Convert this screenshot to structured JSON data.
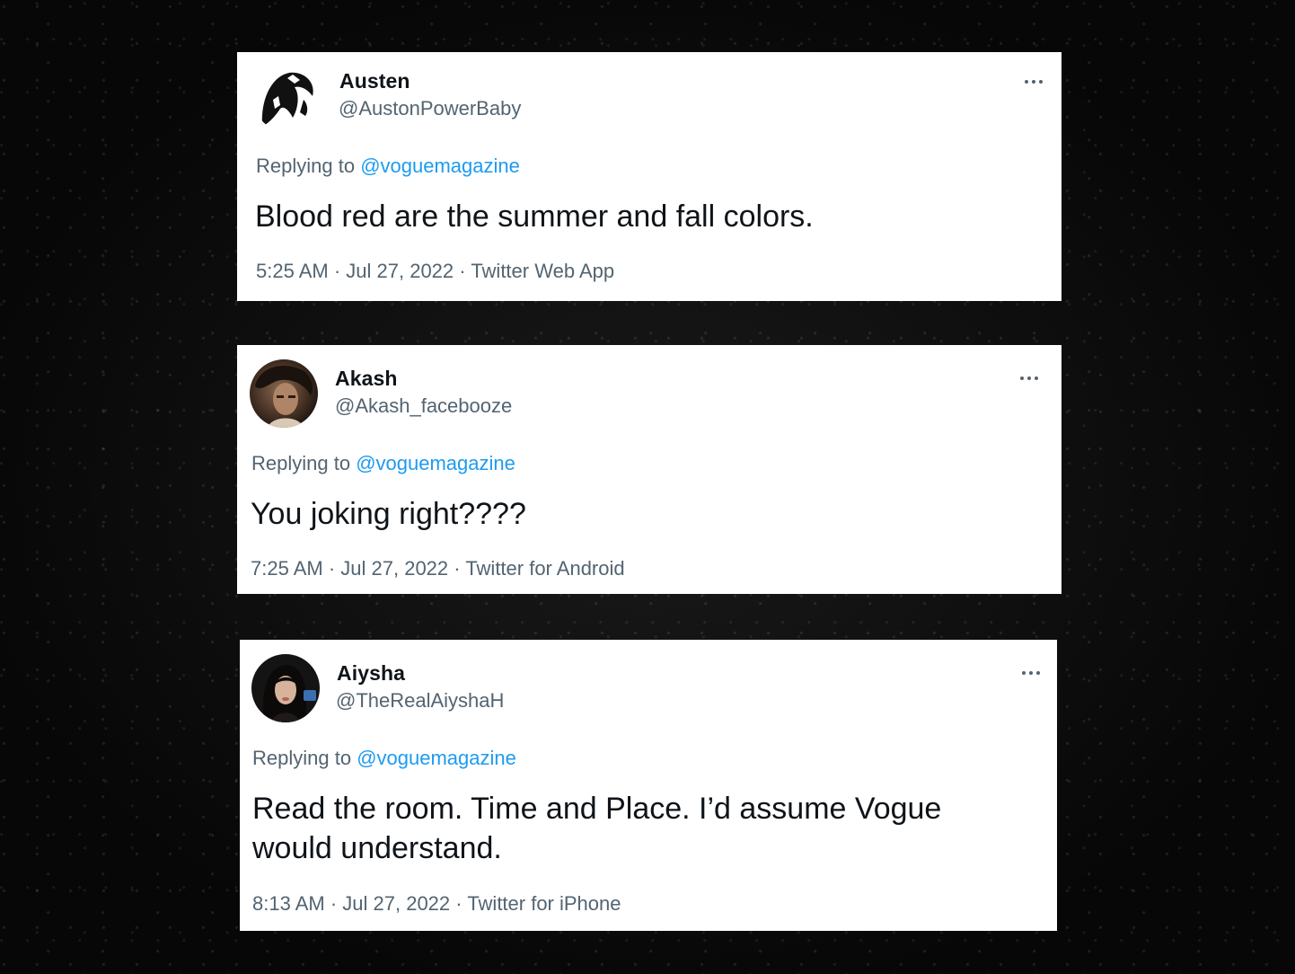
{
  "tweets": [
    {
      "name": "Austen",
      "handle": "@AustonPowerBaby",
      "replying_prefix": "Replying to ",
      "replying_to": "@voguemagazine",
      "text": "Blood red are the summer and fall colors.",
      "time": "5:25 AM",
      "date": "Jul 27, 2022",
      "source": "Twitter Web App"
    },
    {
      "name": "Akash",
      "handle": "@Akash_facebooze",
      "replying_prefix": "Replying to ",
      "replying_to": "@voguemagazine",
      "text": "You joking right????",
      "time": "7:25 AM",
      "date": "Jul 27, 2022",
      "source": "Twitter for Android"
    },
    {
      "name": "Aiysha",
      "handle": "@TheRealAiyshaH",
      "replying_prefix": "Replying to ",
      "replying_to": "@voguemagazine",
      "text": "Read the room. Time and Place. I’d assume Vogue would understand.",
      "time": "8:13 AM",
      "date": "Jul 27, 2022",
      "source": "Twitter for iPhone"
    }
  ],
  "separator": " · ",
  "colors": {
    "card_background": "#ffffff",
    "page_background": "#0b0b0b",
    "text_primary": "#0f1419",
    "text_secondary": "#536471",
    "link": "#1d9bf0"
  },
  "icons": {
    "more": "more-options-icon"
  }
}
